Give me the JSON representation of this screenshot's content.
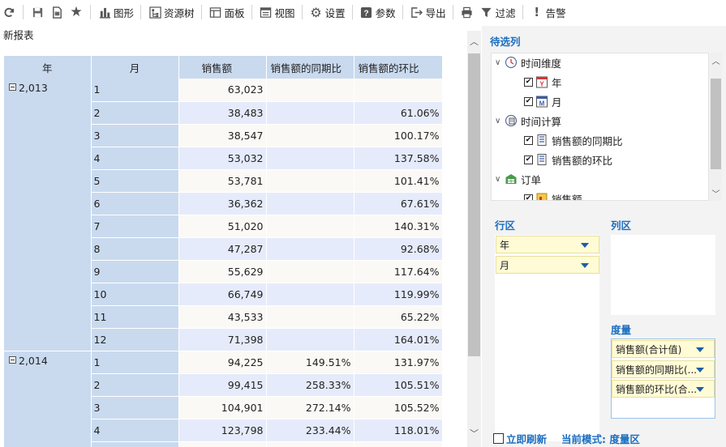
{
  "toolbar": {
    "refresh_icon": "refresh-icon",
    "save_icon": "save-icon",
    "saveas_icon": "save-as-icon",
    "favorite_icon": "star-icon",
    "chart_label": "图形",
    "resource_tree_label": "资源树",
    "panel_label": "面板",
    "view_label": "视图",
    "settings_label": "设置",
    "params_label": "参数",
    "export_label": "导出",
    "filter_label": "过滤",
    "alert_label": "告警"
  },
  "report": {
    "title": "新报表",
    "headers": {
      "year": "年",
      "month": "月",
      "sales": "销售额",
      "yoy": "销售额的同期比",
      "mom": "销售额的环比"
    },
    "groups": [
      {
        "year": "2,013",
        "rows": [
          {
            "month": "1",
            "sales": "63,023",
            "yoy": "",
            "mom": ""
          },
          {
            "month": "2",
            "sales": "38,483",
            "yoy": "",
            "mom": "61.06%"
          },
          {
            "month": "3",
            "sales": "38,547",
            "yoy": "",
            "mom": "100.17%"
          },
          {
            "month": "4",
            "sales": "53,032",
            "yoy": "",
            "mom": "137.58%"
          },
          {
            "month": "5",
            "sales": "53,781",
            "yoy": "",
            "mom": "101.41%"
          },
          {
            "month": "6",
            "sales": "36,362",
            "yoy": "",
            "mom": "67.61%"
          },
          {
            "month": "7",
            "sales": "51,020",
            "yoy": "",
            "mom": "140.31%"
          },
          {
            "month": "8",
            "sales": "47,287",
            "yoy": "",
            "mom": "92.68%"
          },
          {
            "month": "9",
            "sales": "55,629",
            "yoy": "",
            "mom": "117.64%"
          },
          {
            "month": "10",
            "sales": "66,749",
            "yoy": "",
            "mom": "119.99%"
          },
          {
            "month": "11",
            "sales": "43,533",
            "yoy": "",
            "mom": "65.22%"
          },
          {
            "month": "12",
            "sales": "71,398",
            "yoy": "",
            "mom": "164.01%"
          }
        ]
      },
      {
        "year": "2,014",
        "rows": [
          {
            "month": "1",
            "sales": "94,225",
            "yoy": "149.51%",
            "mom": "131.97%"
          },
          {
            "month": "2",
            "sales": "99,415",
            "yoy": "258.33%",
            "mom": "105.51%"
          },
          {
            "month": "3",
            "sales": "104,901",
            "yoy": "272.14%",
            "mom": "105.52%"
          },
          {
            "month": "4",
            "sales": "123,798",
            "yoy": "233.44%",
            "mom": "118.01%"
          },
          {
            "month": "",
            "sales": "",
            "yoy": "",
            "mom": ""
          }
        ]
      }
    ]
  },
  "panel": {
    "candidates_title": "待选列",
    "tree": [
      {
        "label": "时间维度",
        "level": 0,
        "icon": "time-dimension-icon",
        "checkbox": false
      },
      {
        "label": "年",
        "level": 1,
        "icon": "year-calendar-icon",
        "checkbox": true
      },
      {
        "label": "月",
        "level": 1,
        "icon": "month-calendar-icon",
        "checkbox": true
      },
      {
        "label": "时间计算",
        "level": 0,
        "icon": "time-calc-icon",
        "checkbox": false
      },
      {
        "label": "销售额的同期比",
        "level": 1,
        "icon": "measure-calc-icon",
        "checkbox": true
      },
      {
        "label": "销售额的环比",
        "level": 1,
        "icon": "measure-calc-icon",
        "checkbox": true
      },
      {
        "label": "订单",
        "level": 0,
        "icon": "order-table-icon",
        "checkbox": false
      },
      {
        "label": "销售额",
        "level": 1,
        "icon": "measure-icon",
        "checkbox": true
      }
    ],
    "row_zone_title": "行区",
    "row_zone_items": [
      "年",
      "月"
    ],
    "col_zone_title": "列区",
    "measure_zone_title": "度量",
    "measure_items": [
      "销售额(合计值)",
      "销售额的同期比(...",
      "销售额的环比(合..."
    ],
    "instant_refresh_label": "立即刷新",
    "mode_label": "当前模式: 度量区"
  },
  "colors": {
    "header_bg": "#c9daef",
    "row_odd": "#fbf9f6",
    "row_even": "#e6ebfb",
    "accent": "#1a6ec1",
    "pill_bg": "#fffbd6"
  }
}
